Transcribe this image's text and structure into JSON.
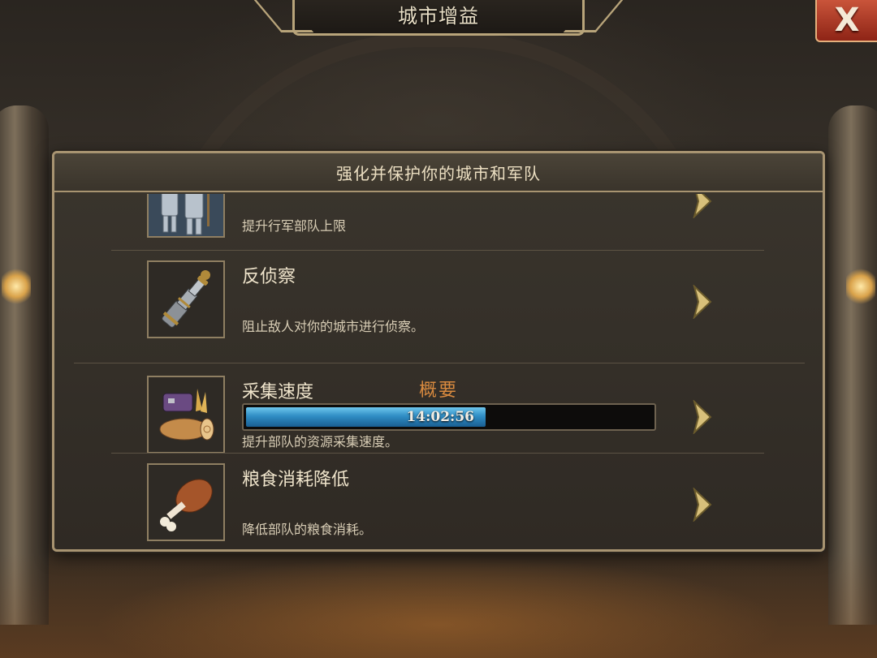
{
  "window": {
    "title": "城市增益",
    "close_label": "X"
  },
  "panel": {
    "header": "强化并保护你的城市和军队"
  },
  "items": [
    {
      "name": "",
      "description": "提升行军部队上限",
      "icon": "knights-icon"
    },
    {
      "name": "反侦察",
      "description": "阻止敌人对你的城市进行侦察。",
      "icon": "spyglass-icon"
    }
  ],
  "section": {
    "heading": "概要"
  },
  "summary_items": [
    {
      "name": "采集速度",
      "description": "提升部队的资源采集速度。",
      "icon": "resource-bundle-icon",
      "timer": "14:02:56",
      "progress": 0.59
    },
    {
      "name": "粮食消耗降低",
      "description": "降低部队的粮食消耗。",
      "icon": "meat-drumstick-icon"
    }
  ],
  "colors": {
    "accent_heading": "#d98a3f",
    "progress_fill": "#2f8dc4",
    "frame_gold": "#a89471"
  }
}
